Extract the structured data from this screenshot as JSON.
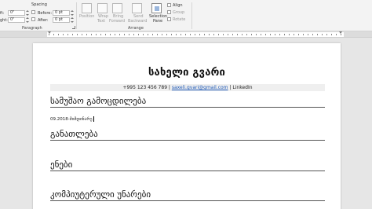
{
  "ribbon": {
    "indent": {
      "left_value": "0\"",
      "right_value": "0\"",
      "left_partial": "ft:",
      "right_partial": "ght:"
    },
    "spacing": {
      "title": "Spacing",
      "before_label": "Before:",
      "before_value": "0 pt",
      "after_label": "After:",
      "after_value": "0 pt"
    },
    "paragraph_group": "Paragraph",
    "arrange_group": "Arrange",
    "arrange": {
      "position": "Position",
      "wrap_text": [
        "Wrap",
        "Text"
      ],
      "bring_forward": [
        "Bring",
        "Forward"
      ],
      "send_backward": [
        "Send",
        "Backward"
      ],
      "selection_pane": [
        "Selection",
        "Pane"
      ],
      "align": "Align",
      "group": "Group",
      "rotate": "Rotate"
    }
  },
  "document": {
    "name": "სახელი გვარი",
    "contact": {
      "phone": "+995 123 456 789",
      "separator": " | ",
      "email": "saxeli.gvari@gmail.com",
      "linkedin": "LinkedIn"
    },
    "sections": {
      "experience": "სამუშაო გამოცდილება",
      "education": "განათლება",
      "languages": "ენები",
      "computer_skills": "კომპიუტერული უნარები"
    },
    "experience_entry": "09.2018-მიმდინარე"
  }
}
